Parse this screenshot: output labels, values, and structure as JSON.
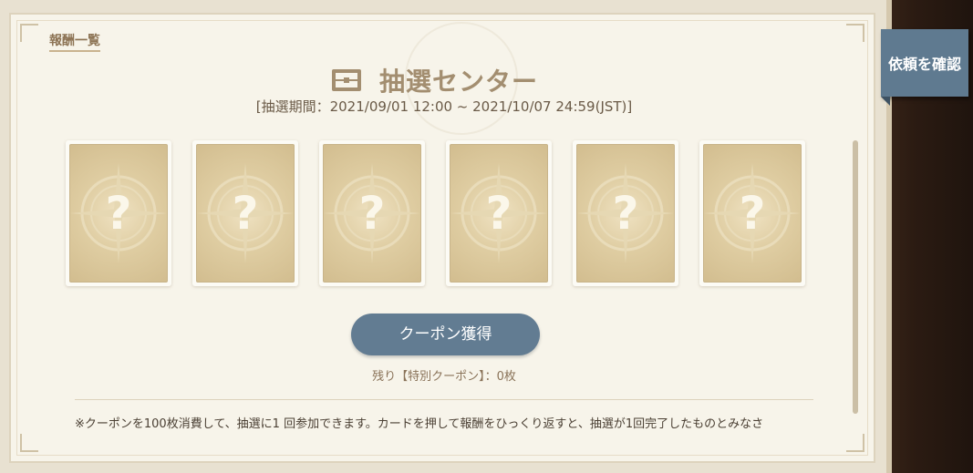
{
  "header": {
    "rewards_link": "報酬一覧",
    "title": "抽選センター",
    "title_icon": "treasure-chest-icon",
    "period": "[抽選期間：2021/09/01 12:00 ~ 2021/10/07 24:59(JST)]"
  },
  "side": {
    "check_request_label": "依頼を確認"
  },
  "cards": [
    {
      "label": "?",
      "icon": "mystery-card-icon"
    },
    {
      "label": "?",
      "icon": "mystery-card-icon"
    },
    {
      "label": "?",
      "icon": "mystery-card-icon"
    },
    {
      "label": "?",
      "icon": "mystery-card-icon"
    },
    {
      "label": "?",
      "icon": "mystery-card-icon"
    },
    {
      "label": "?",
      "icon": "mystery-card-icon"
    }
  ],
  "actions": {
    "get_coupon_label": "クーポン獲得",
    "remaining": "残り【特別クーポン】：0枚"
  },
  "footer": {
    "note": "※クーポンを100枚消費して、抽選に1 回参加できます。カードを押して報酬をひっくり返すと、抽選が1回完了したものとみなさ"
  },
  "colors": {
    "accent_button": "#627c92",
    "panel": "#f7f4ea",
    "card_gold": "#d9c597"
  }
}
